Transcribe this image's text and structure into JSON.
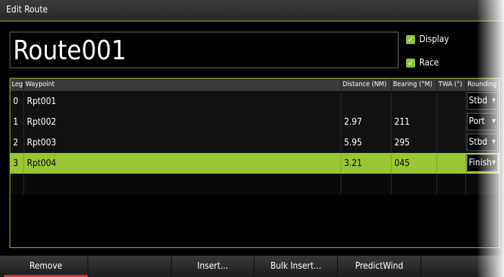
{
  "window": {
    "title": "Edit Route"
  },
  "route": {
    "name": "Route001"
  },
  "options": {
    "display_label": "Display",
    "race_label": "Race",
    "display_checked": true,
    "race_checked": true
  },
  "table": {
    "headers": {
      "leg": "Leg",
      "waypoint": "Waypoint",
      "distance": "Distance (NM)",
      "bearing": "Bearing (°M)",
      "twa": "TWA (°)",
      "rounding": "Rounding"
    },
    "rows": [
      {
        "leg": "0",
        "waypoint": "Rpt001",
        "distance": "",
        "bearing": "",
        "twa": "",
        "rounding": "Stbd"
      },
      {
        "leg": "1",
        "waypoint": "Rpt002",
        "distance": "2.97",
        "bearing": "211",
        "twa": "",
        "rounding": "Port"
      },
      {
        "leg": "2",
        "waypoint": "Rpt003",
        "distance": "5.95",
        "bearing": "295",
        "twa": "",
        "rounding": "Stbd"
      },
      {
        "leg": "3",
        "waypoint": "Rpt004",
        "distance": "3.21",
        "bearing": "045",
        "twa": "",
        "rounding": "Finish"
      }
    ],
    "selected_row": 3
  },
  "toolbar": {
    "remove": "Remove",
    "insert": "Insert...",
    "bulk_insert": "Bulk Insert...",
    "predictwind": "PredictWind"
  },
  "colors": {
    "accent": "#9ac534",
    "active_indicator": "#dd3333"
  },
  "icons": {
    "checkbox": "check-icon",
    "dropdown": "chevron-down-icon"
  }
}
